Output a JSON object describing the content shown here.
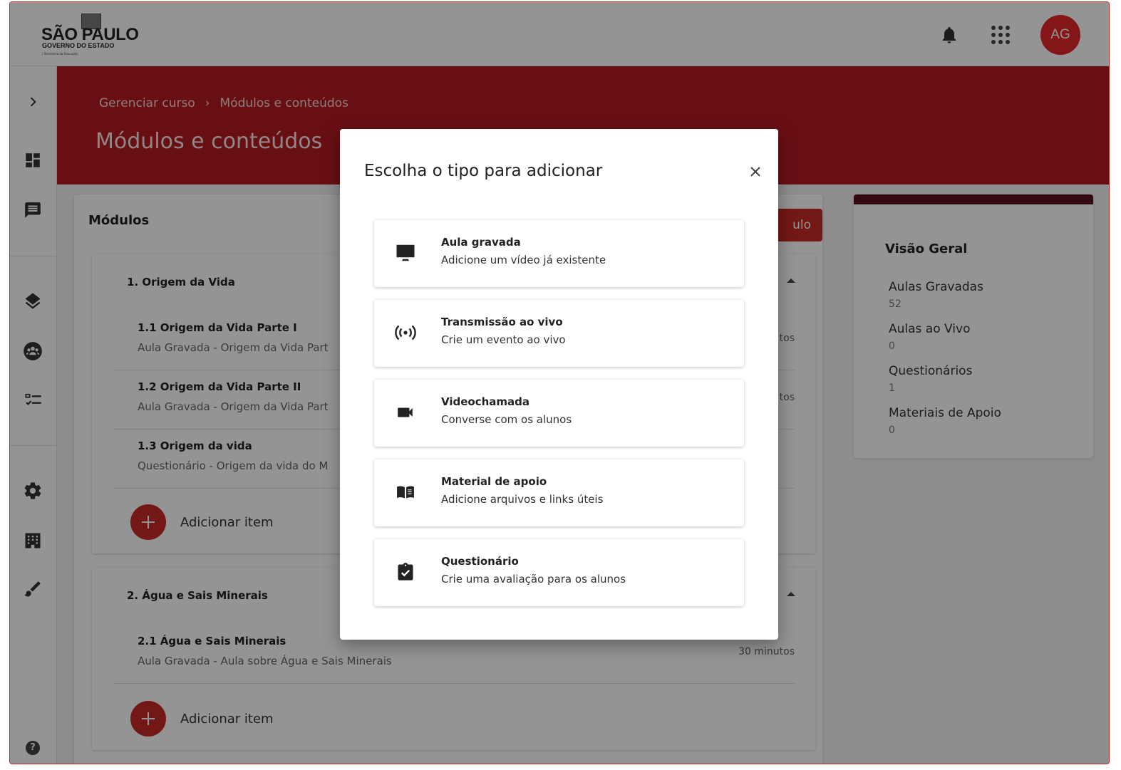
{
  "brand": {
    "line1": "SÃO PAULO",
    "line2": "GOVERNO DO ESTADO",
    "line3": "| Secretaria da Educação"
  },
  "user": {
    "initials": "AG"
  },
  "breadcrumb": {
    "parent": "Gerenciar curso",
    "separator": "›",
    "current": "Módulos e conteúdos"
  },
  "page_title": "Módulos e conteúdos",
  "modules_panel": {
    "title": "Módulos",
    "new_module_label": "ulo",
    "modules": [
      {
        "title": "1. Origem da Vida",
        "items": [
          {
            "title": "1.1 Origem da Vida Parte I",
            "subtitle": "Aula Gravada - Origem da Vida Part",
            "duration": "tos"
          },
          {
            "title": "1.2 Origem da Vida Parte II",
            "subtitle": "Aula Gravada - Origem da Vida Part",
            "duration": "tos"
          },
          {
            "title": "1.3 Origem da vida",
            "subtitle": "Questionário - Origem da vida do M",
            "duration": ""
          }
        ],
        "add_label": "Adicionar item"
      },
      {
        "title": "2. Água e Sais Minerais",
        "items": [
          {
            "title": "2.1 Água e Sais Minerais",
            "subtitle": "Aula Gravada - Aula sobre Água e Sais Minerais",
            "duration": "30 minutos"
          }
        ],
        "add_label": "Adicionar item"
      }
    ]
  },
  "overview": {
    "title": "Visão Geral",
    "stats": [
      {
        "label": "Aulas Gravadas",
        "value": "52"
      },
      {
        "label": "Aulas ao Vivo",
        "value": "0"
      },
      {
        "label": "Questionários",
        "value": "1"
      },
      {
        "label": "Materiais de Apoio",
        "value": "0"
      }
    ]
  },
  "dialog": {
    "title": "Escolha o tipo para adicionar",
    "options": [
      {
        "title": "Aula gravada",
        "subtitle": "Adicione um vídeo já existente",
        "icon": "monitor-icon"
      },
      {
        "title": "Transmissão ao vivo",
        "subtitle": "Crie um evento ao vivo",
        "icon": "live-broadcast-icon"
      },
      {
        "title": "Videochamada",
        "subtitle": "Converse com os alunos",
        "icon": "videocam-icon"
      },
      {
        "title": "Material de apoio",
        "subtitle": "Adicione arquivos e links úteis",
        "icon": "book-icon"
      },
      {
        "title": "Questionário",
        "subtitle": "Crie uma avaliação para os alunos",
        "icon": "clipboard-check-icon"
      }
    ]
  },
  "help_label": "?"
}
